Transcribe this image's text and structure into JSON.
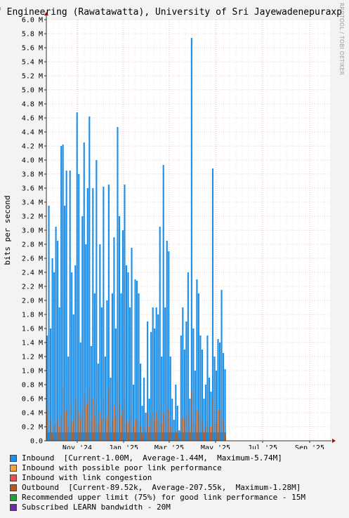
{
  "title": "f Engineering (Rawatawatta), University of Sri Jayewadenepuraxp",
  "watermark": "RRDTOOL / TOBI OETIKER",
  "chart_data": {
    "type": "bar",
    "ylabel": "bits per second",
    "ylim": [
      0,
      6000000
    ],
    "yticks": [
      "0.0",
      "0.2 M",
      "0.4 M",
      "0.6 M",
      "0.8 M",
      "1.0 M",
      "1.2 M",
      "1.4 M",
      "1.6 M",
      "1.8 M",
      "2.0 M",
      "2.2 M",
      "2.4 M",
      "2.6 M",
      "2.8 M",
      "3.0 M",
      "3.2 M",
      "3.4 M",
      "3.6 M",
      "3.8 M",
      "4.0 M",
      "4.2 M",
      "4.4 M",
      "4.6 M",
      "4.8 M",
      "5.0 M",
      "5.2 M",
      "5.4 M",
      "5.6 M",
      "5.8 M",
      "6.0 M"
    ],
    "xticks": [
      "Nov '24",
      "Jan '25",
      "Mar '25",
      "May '25",
      "Jul '25",
      "Sep '25"
    ],
    "grid": true,
    "colors": {
      "inbound": "#1e8fe8",
      "outbound": "#b35a22",
      "grid_major": "#e89a9a",
      "grid_minor": "#e8c8c8",
      "axis": "#333333",
      "arrow": "#b30000"
    },
    "inbound_series": {
      "name": "Inbound",
      "values": [
        1.5,
        3.35,
        1.6,
        2.6,
        2.4,
        3.05,
        2.85,
        1.9,
        4.2,
        4.22,
        3.35,
        3.85,
        1.2,
        3.85,
        2.4,
        1.8,
        2.5,
        4.68,
        3.8,
        1.4,
        3.2,
        4.25,
        2.8,
        3.6,
        4.62,
        1.35,
        3.6,
        2.1,
        4.0,
        1.1,
        2.8,
        1.9,
        3.62,
        1.2,
        2.0,
        3.65,
        0.9,
        2.1,
        2.9,
        1.6,
        4.47,
        3.2,
        2.1,
        3.0,
        3.65,
        2.5,
        2.4,
        1.9,
        2.75,
        0.8,
        2.3,
        2.28,
        2.1,
        1.1,
        0.5,
        0.9,
        0.4,
        1.7,
        0.6,
        1.55,
        1.9,
        1.6,
        1.9,
        1.8,
        3.05,
        1.2,
        3.93,
        1.9,
        2.85,
        2.7,
        1.2,
        0.6,
        0.3,
        0.8,
        0.5,
        0.15,
        1.5,
        1.9,
        1.3,
        1.7,
        2.4,
        0.6,
        5.74,
        1.6,
        1.0,
        2.3,
        2.1,
        1.5,
        1.3,
        0.6,
        0.8,
        1.5,
        0.9,
        0.7,
        3.88,
        1.2,
        1.0,
        1.45,
        1.4,
        2.15,
        1.25,
        1.02
      ],
      "current": "1.00M",
      "average": "1.44M",
      "maximum": "5.74M"
    },
    "outbound_series": {
      "name": "Outbound",
      "values": [
        0.42,
        0.15,
        0.3,
        0.1,
        0.2,
        0.25,
        0.3,
        0.2,
        0.35,
        0.76,
        0.4,
        0.45,
        0.2,
        0.5,
        0.25,
        0.3,
        0.6,
        0.55,
        0.4,
        0.3,
        0.45,
        0.65,
        0.5,
        0.55,
        0.75,
        0.3,
        0.6,
        0.35,
        0.55,
        0.25,
        0.4,
        0.3,
        0.6,
        0.3,
        0.35,
        0.75,
        0.2,
        0.3,
        0.5,
        0.35,
        0.85,
        0.55,
        0.35,
        0.45,
        0.6,
        0.3,
        0.25,
        0.3,
        0.4,
        0.2,
        0.3,
        0.3,
        0.25,
        0.2,
        0.1,
        0.2,
        0.15,
        0.4,
        0.2,
        0.35,
        0.4,
        0.3,
        0.4,
        0.3,
        0.55,
        0.25,
        0.4,
        0.3,
        0.5,
        0.45,
        0.2,
        0.15,
        0.1,
        0.15,
        0.12,
        0.05,
        0.3,
        0.35,
        0.3,
        0.35,
        0.4,
        0.15,
        0.7,
        0.3,
        0.25,
        0.45,
        0.4,
        0.3,
        0.3,
        0.15,
        0.2,
        0.3,
        0.2,
        0.2,
        0.6,
        0.25,
        0.25,
        0.45,
        0.45,
        0.4,
        0.3,
        0.09
      ],
      "current": "89.52k",
      "average": "207.55k",
      "maximum": "1.28M"
    }
  },
  "legend": [
    {
      "label": "Inbound  [Current-1.00M,  Average-1.44M,  Maximum-5.74M]",
      "color": "#1e8fe8"
    },
    {
      "label": "Inbound with possible poor link performance",
      "color": "#f0a040"
    },
    {
      "label": "Inbound with link congestion",
      "color": "#e85050"
    },
    {
      "label": "Outbound  [Current-89.52k,  Average-207.55k,  Maximum-1.28M]",
      "color": "#b35a22"
    },
    {
      "label": "Recommended upper limit (75%) for good link performance - 15M",
      "color": "#2a9a3a"
    },
    {
      "label": "Subscribed LEARN bandwidth - 20M",
      "color": "#6a2aa8"
    }
  ]
}
